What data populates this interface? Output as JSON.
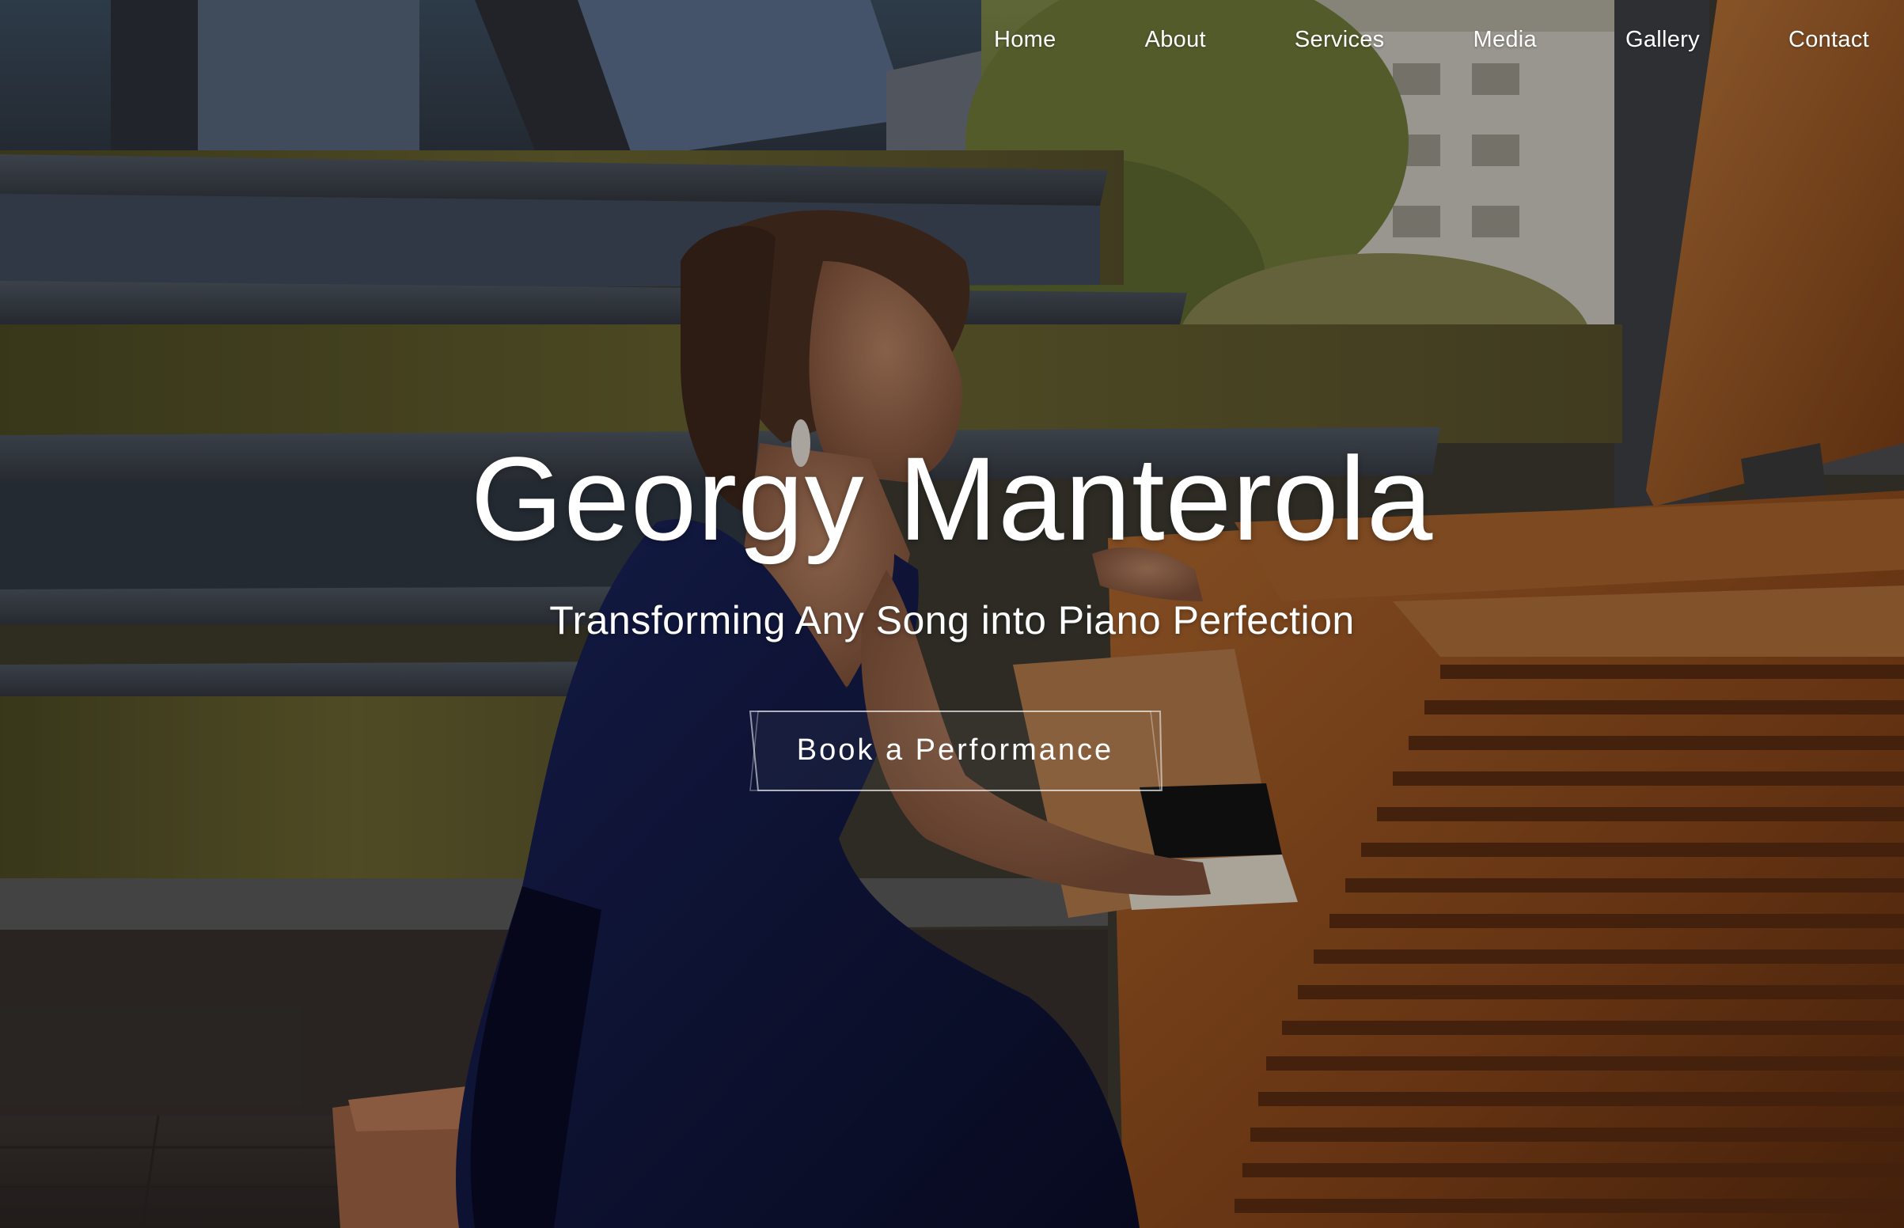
{
  "nav": {
    "items": [
      {
        "label": "Home"
      },
      {
        "label": "About"
      },
      {
        "label": "Services"
      },
      {
        "label": "Media"
      },
      {
        "label": "Gallery"
      },
      {
        "label": "Contact"
      }
    ]
  },
  "hero": {
    "title": "Georgy Manterola",
    "subtitle": "Transforming Any Song into Piano Perfection",
    "cta_label": "Book a Performance",
    "background_image": "pianist-playing-grand-piano-outdoors"
  },
  "colors": {
    "text": "#ffffff",
    "wood": "#a05a25",
    "dress": "#0b1240",
    "moss": "#5d5a2a",
    "steps": "#4a5460"
  }
}
